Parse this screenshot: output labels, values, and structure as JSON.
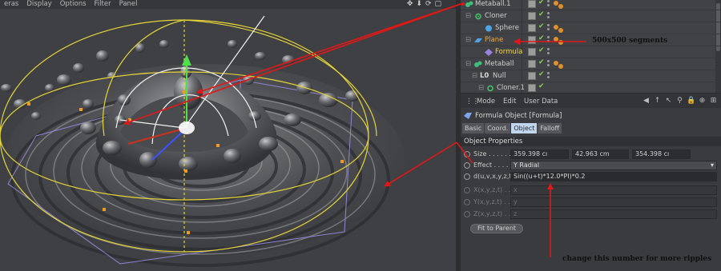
{
  "viewport": {
    "menu": [
      "eras",
      "Display",
      "Options",
      "Filter",
      "Panel"
    ],
    "nav_icons": [
      "move-view-icon",
      "zoom-view-icon",
      "rotate-view-icon",
      "maximize-view-icon"
    ]
  },
  "object_manager": {
    "objects": [
      {
        "name": "Metaball.1",
        "icon": "metaball-icon",
        "color": "#cfcfcf"
      },
      {
        "name": "Cloner",
        "icon": "cloner-icon",
        "color": "#cfcfcf"
      },
      {
        "name": "Sphere",
        "icon": "sphere-icon",
        "color": "#cfcfcf"
      },
      {
        "name": "Plane",
        "icon": "plane-icon",
        "color": "#f0a83a"
      },
      {
        "name": "Formula",
        "icon": "formula-icon",
        "color": "#f5d24a"
      },
      {
        "name": "Metaball",
        "icon": "metaball-icon",
        "color": "#cfcfcf"
      },
      {
        "name": "Null",
        "icon": "null-icon",
        "color": "#cfcfcf"
      },
      {
        "name": "Cloner.1",
        "icon": "cloner-icon",
        "color": "#cfcfcf"
      }
    ]
  },
  "attribute_manager": {
    "menu": [
      "Mode",
      "Edit",
      "User Data"
    ],
    "title": "Formula Object [Formula]",
    "tabs": [
      "Basic",
      "Coord.",
      "Object",
      "Falloff"
    ],
    "active_tab": "Object",
    "section": "Object Properties",
    "size": {
      "label": "Size . . . . . .",
      "x": "359.398 cı",
      "y": "42.963 cm",
      "z": "354.398 cı"
    },
    "effect": {
      "label": "Effect . . . . .",
      "value": "Y Radial"
    },
    "formula": {
      "label": "d(u,v,x,y,z,t)",
      "value": "Sin((u+t)*12.0*PI)*0.2"
    },
    "x_func": {
      "label": "X(x,y,z,t) . . .",
      "value": "x"
    },
    "y_func": {
      "label": "Y(x,y,z,t) . . .",
      "value": "y"
    },
    "z_func": {
      "label": "Z(x,y,z,t) . . .",
      "value": "z"
    },
    "fit_button": "Fit to Parent"
  },
  "annotations": {
    "segments": "500x500 segments",
    "ripples": "change this number for more ripples"
  },
  "colors": {
    "annotation_arrow": "#e01818",
    "accent_tab": "#c2d6ee",
    "check_green": "#7fd34a"
  }
}
